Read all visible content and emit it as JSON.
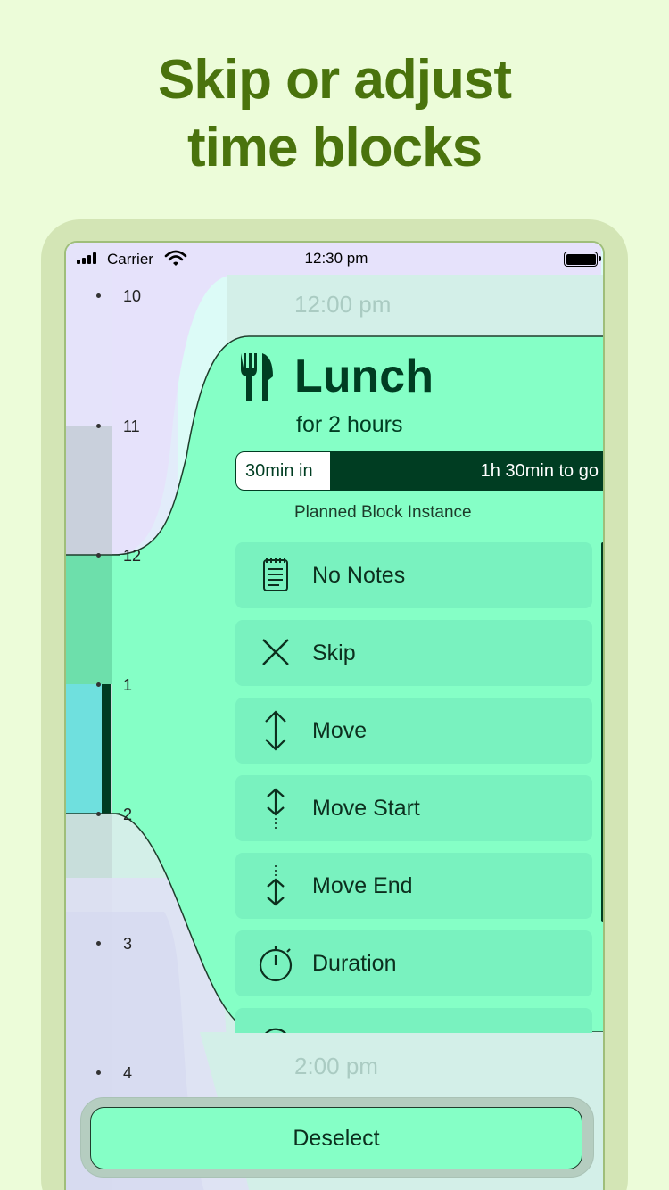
{
  "headline": {
    "line1": "Skip or adjust",
    "line2": "time blocks"
  },
  "status_bar": {
    "carrier": "Carrier",
    "time": "12:30 pm"
  },
  "timeline": {
    "hours": [
      "10",
      "11",
      "12",
      "1",
      "2",
      "3",
      "4"
    ],
    "ghost_start": "12:00 pm",
    "ghost_end": "2:00 pm"
  },
  "block": {
    "icon": "fork-knife-icon",
    "title": "Lunch",
    "subtitle": "for 2 hours",
    "progress_fraction": 0.25,
    "progress_elapsed": "30min in",
    "progress_remaining": "1h 30min to go",
    "instance_label": "Planned Block Instance"
  },
  "actions": [
    {
      "icon": "notes-icon",
      "label": "No Notes"
    },
    {
      "icon": "close-icon",
      "label": "Skip"
    },
    {
      "icon": "move-icon",
      "label": "Move"
    },
    {
      "icon": "move-start-icon",
      "label": "Move Start"
    },
    {
      "icon": "move-end-icon",
      "label": "Move End"
    },
    {
      "icon": "timer-icon",
      "label": "Duration"
    },
    {
      "icon": "history-icon",
      "label": ""
    }
  ],
  "deselect_label": "Deselect",
  "colors": {
    "background": "#ecfcd9",
    "headline": "#4a730d",
    "block": "#85ffc6",
    "block_dark": "#003d22",
    "current_hour": "#6fe0de"
  }
}
